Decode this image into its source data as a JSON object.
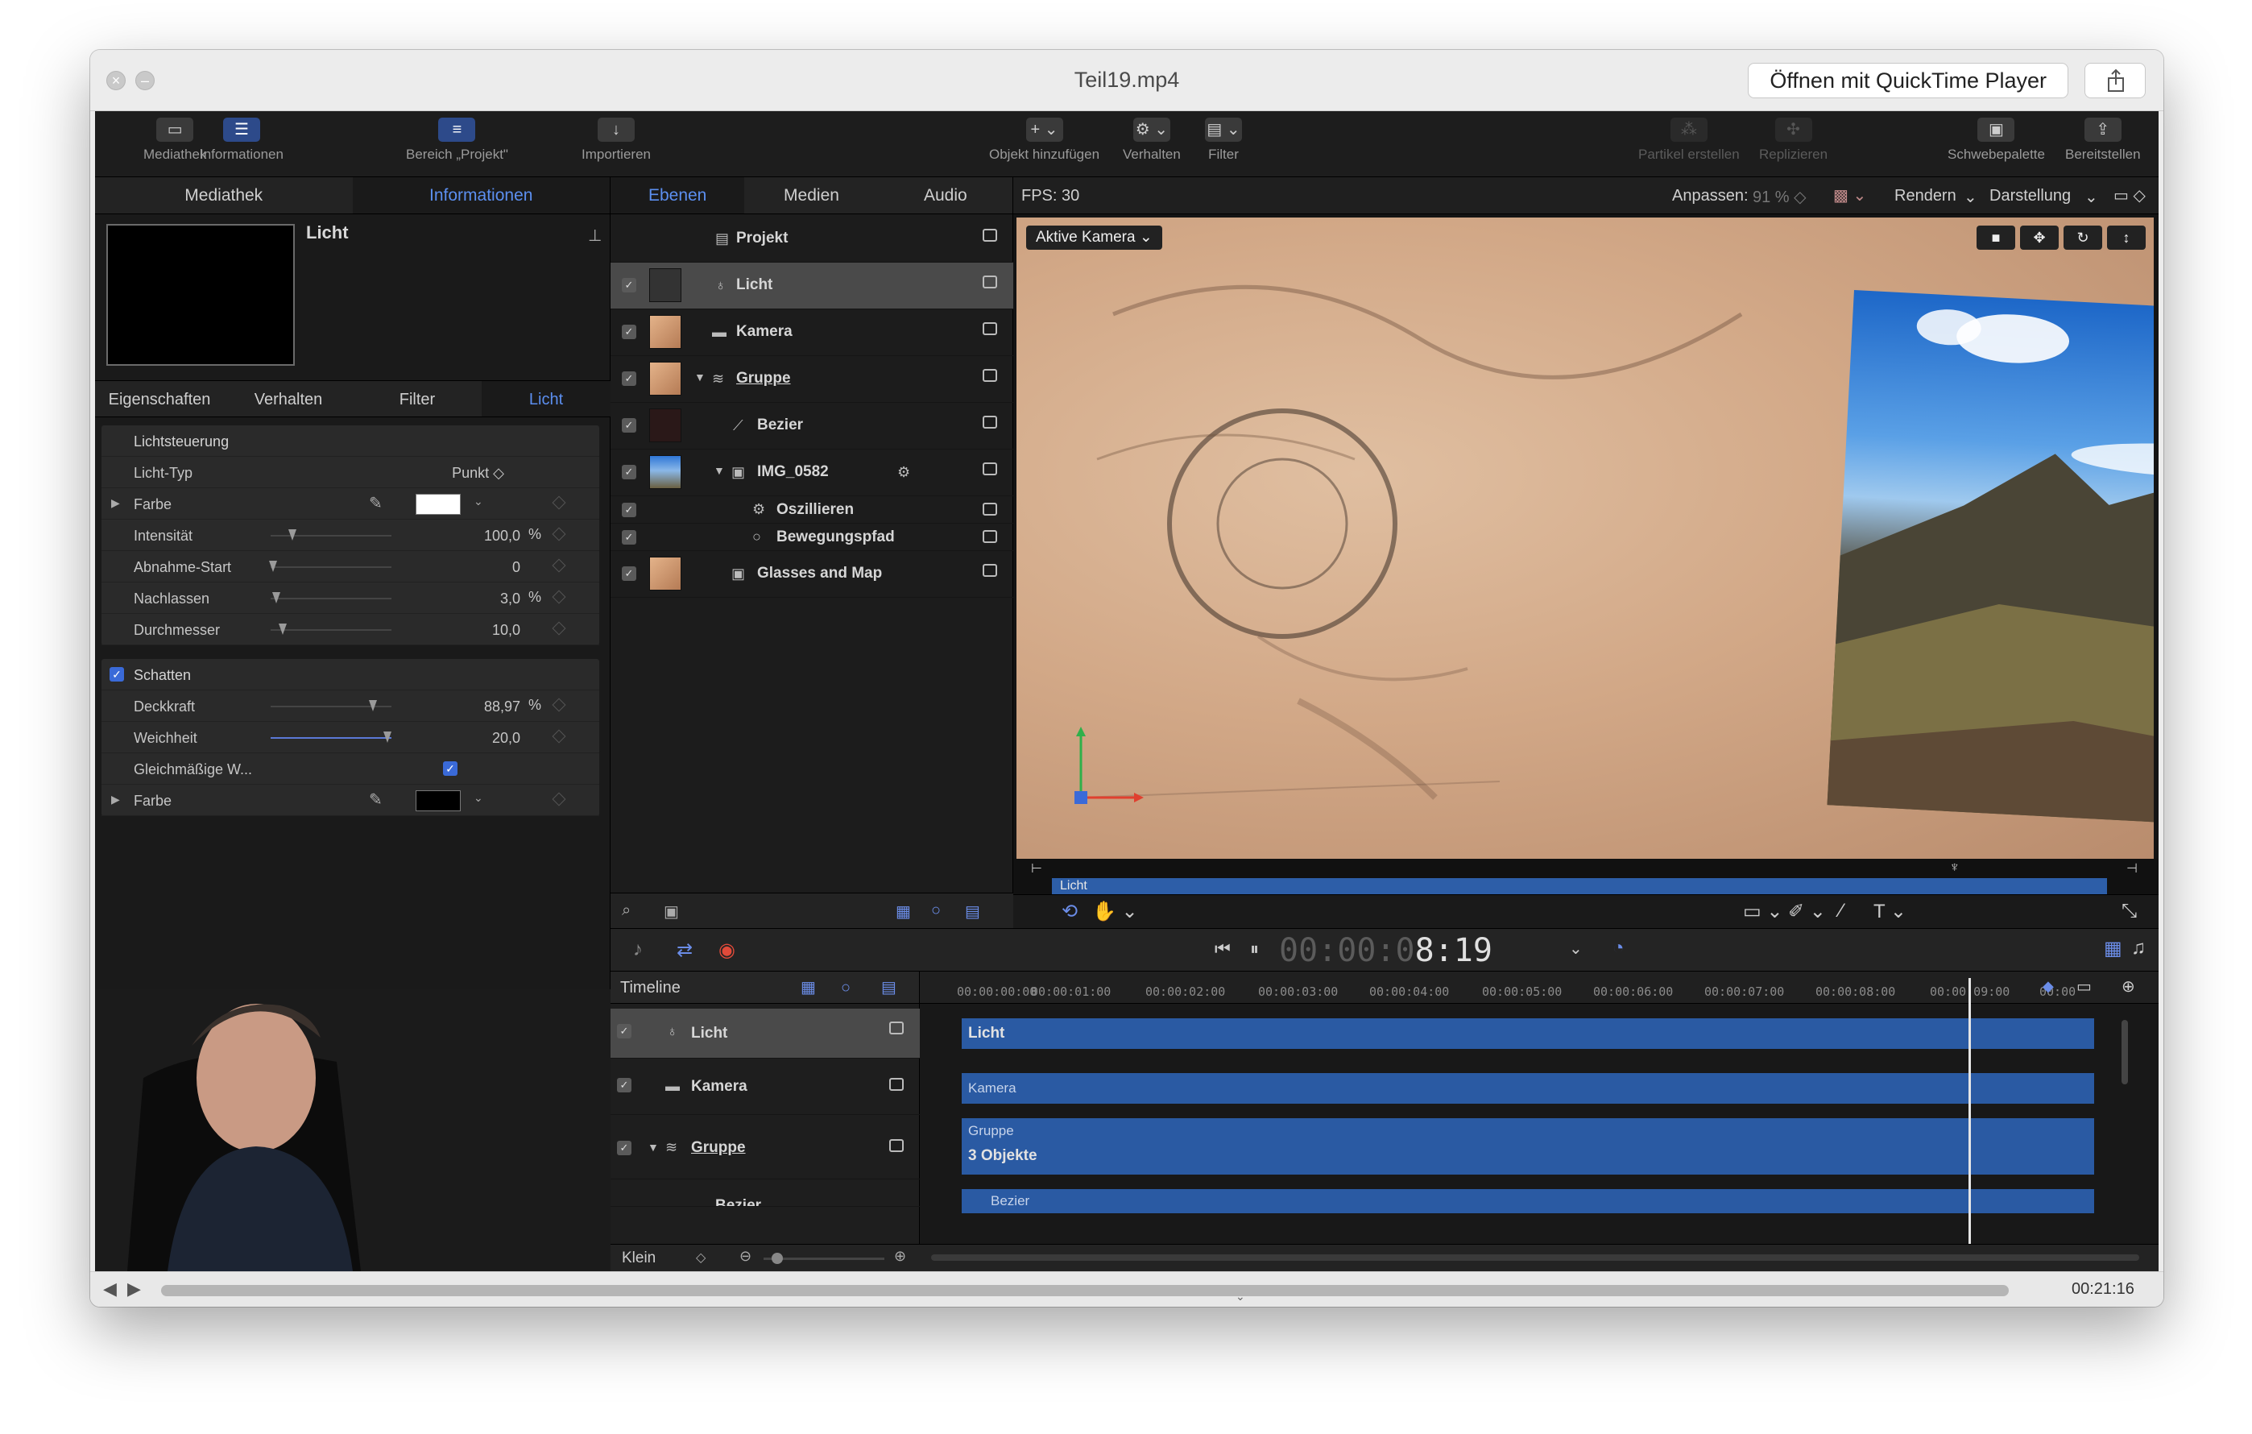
{
  "window": {
    "title": "Teil19.mp4",
    "open_button": "Öffnen mit QuickTime Player",
    "elapsed": "00:21:16"
  },
  "toolbar": {
    "mediathek": "Mediathek",
    "informationen": "Informationen",
    "bereich": "Bereich „Projekt\"",
    "importieren": "Importieren",
    "objekt": "Objekt hinzufügen",
    "verhalten": "Verhalten",
    "filter": "Filter",
    "partikel": "Partikel erstellen",
    "replizieren": "Replizieren",
    "schwebepalette": "Schwebepalette",
    "bereitstellen": "Bereitstellen"
  },
  "left_tabs": [
    "Mediathek",
    "Informationen"
  ],
  "object_name": "Licht",
  "inspector_tabs": [
    "Eigenschaften",
    "Verhalten",
    "Filter",
    "Licht"
  ],
  "light": {
    "section": "Lichtsteuerung",
    "type_label": "Licht-Typ",
    "type_value": "Punkt ◇",
    "color_label": "Farbe",
    "intensity_label": "Intensität",
    "intensity_value": "100,0",
    "intensity_unit": "%",
    "falloff_start_label": "Abnahme-Start",
    "falloff_start_value": "0",
    "falloff_label": "Nachlassen",
    "falloff_value": "3,0",
    "falloff_unit": "%",
    "diameter_label": "Durchmesser",
    "diameter_value": "10,0"
  },
  "shadow": {
    "section": "Schatten",
    "opacity_label": "Deckkraft",
    "opacity_value": "88,97",
    "opacity_unit": "%",
    "softness_label": "Weichheit",
    "softness_value": "20,0",
    "uniform_label": "Gleichmäßige W...",
    "color_label": "Farbe"
  },
  "layer_tabs": [
    "Ebenen",
    "Medien",
    "Audio"
  ],
  "layers": [
    "Projekt",
    "Licht",
    "Kamera",
    "Gruppe",
    "Bezier",
    "IMG_0582",
    "Oszillieren",
    "Bewegungspfad",
    "Glasses and Map"
  ],
  "viewer": {
    "fps": "FPS: 30",
    "fit": "Anpassen:",
    "fit_value": "91 % ◇",
    "render": "Rendern",
    "view": "Darstellung",
    "camera": "Aktive Kamera",
    "mini_track": "Licht"
  },
  "timecode": {
    "dim": "00:00:0",
    "hi": "8:19"
  },
  "timeline": {
    "label": "Timeline",
    "rows": [
      "Licht",
      "Kamera",
      "Gruppe",
      "Bezier"
    ],
    "zoom": "Klein",
    "ticks": [
      "00:00:00:00",
      "00:00:01:00",
      "00:00:02:00",
      "00:00:03:00",
      "00:00:04:00",
      "00:00:05:00",
      "00:00:06:00",
      "00:00:07:00",
      "00:00:08:00",
      "00:00:09:00",
      "00:00"
    ],
    "tracks": {
      "licht": "Licht",
      "kamera": "Kamera",
      "gruppe": "Gruppe",
      "gruppe_count": "3 Objekte",
      "bezier": "Bezier"
    }
  }
}
